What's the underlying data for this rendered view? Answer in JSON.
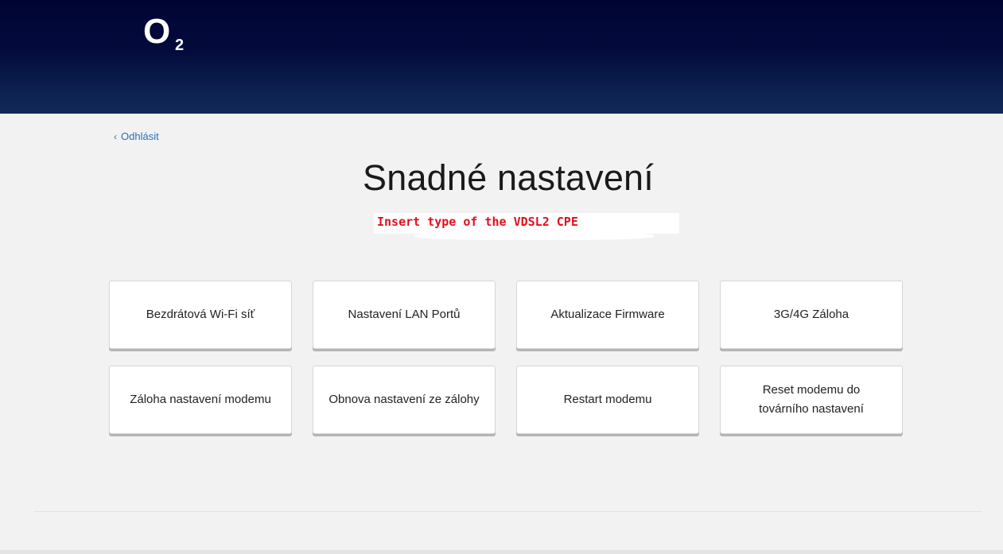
{
  "header": {
    "logo_text": "O",
    "logo_sub": "2"
  },
  "nav": {
    "logout_label": "Odhlásit",
    "logout_icon": "chevron-left-icon"
  },
  "page": {
    "title": "Snadné nastavení",
    "note": "Insert type of the VDSL2 CPE"
  },
  "tiles": [
    {
      "label": "Bezdrátová Wi-Fi síť"
    },
    {
      "label": "Nastavení LAN Portů"
    },
    {
      "label": "Aktualizace Firmware"
    },
    {
      "label": "3G/4G Záloha"
    },
    {
      "label": "Záloha nastavení modemu"
    },
    {
      "label": "Obnova nastavení ze zálohy"
    },
    {
      "label": "Restart modemu"
    },
    {
      "label": "Reset modemu do továrního nastavení"
    }
  ],
  "colors": {
    "header_dark": "#000433",
    "header_light": "#112a58",
    "link": "#2a6fb5",
    "note_red": "#e0101e",
    "background": "#f2f2f2"
  }
}
